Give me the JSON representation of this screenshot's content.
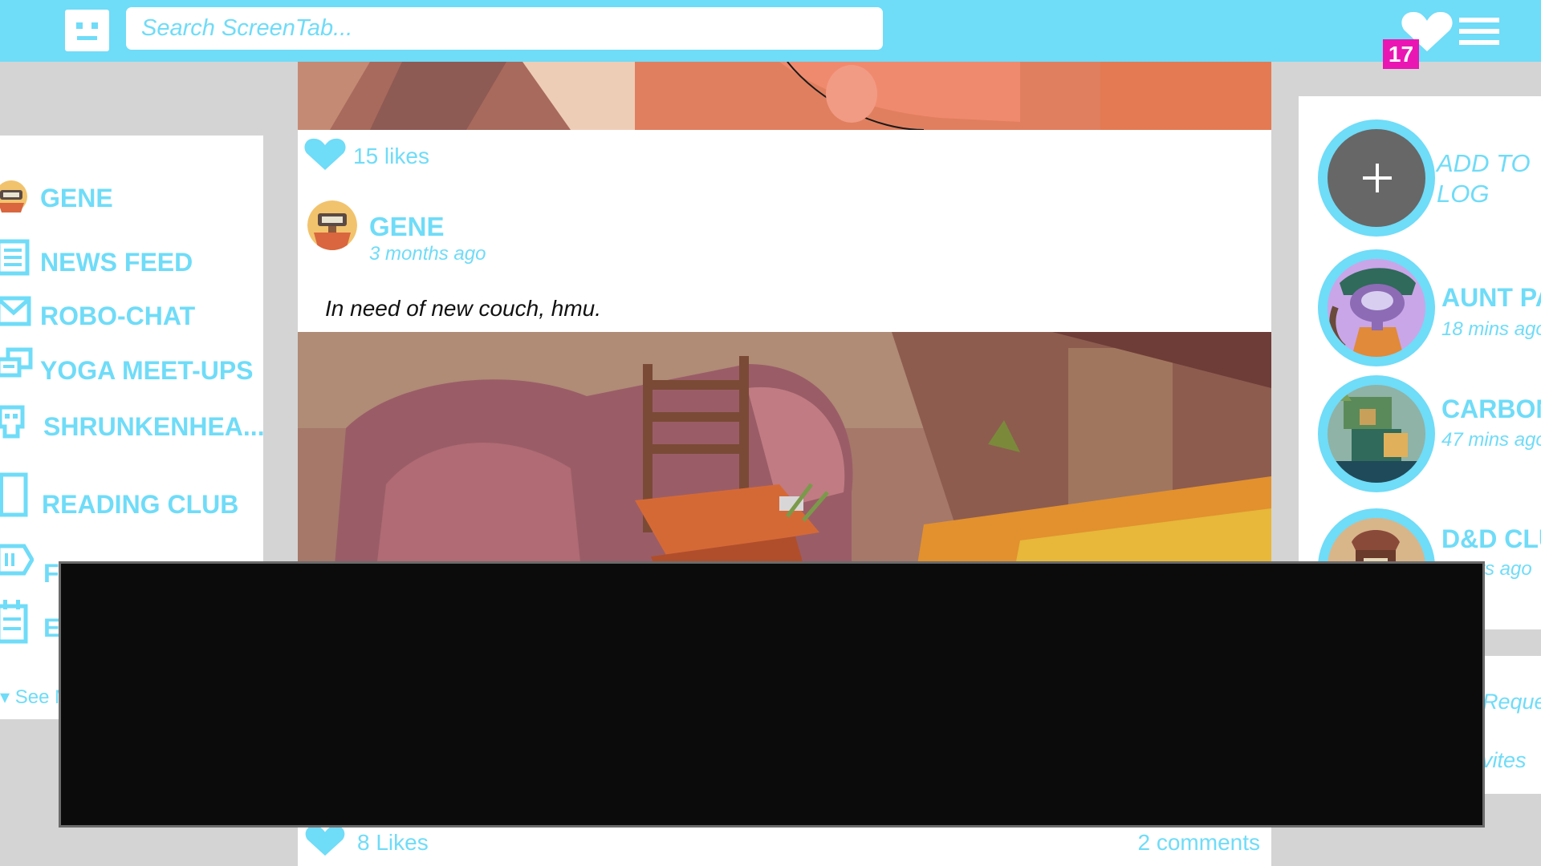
{
  "colors": {
    "accent": "#6fdcf8",
    "background": "#d4d4d4",
    "badge": "#ea16b3",
    "overlay": "#0b0b0b"
  },
  "topbar": {
    "logo_icon": "robot-face-icon",
    "search_placeholder": "Search ScreenTab...",
    "notification_icon": "heart-icon",
    "notification_count": "17",
    "menu_icon": "hamburger-menu-icon"
  },
  "sidebar": {
    "items": [
      {
        "label": "GENE",
        "icon": "avatar-icon"
      },
      {
        "label": "NEWS FEED",
        "icon": "newspaper-icon"
      },
      {
        "label": "ROBO-CHAT",
        "icon": "mail-icon"
      },
      {
        "label": "YOGA MEET-UPS",
        "icon": "chat-bubbles-icon"
      },
      {
        "label": "SHRUNKENHEA...",
        "icon": "skull-icon"
      },
      {
        "label": "READING CLUB",
        "icon": "book-icon"
      },
      {
        "label": "F",
        "icon": "tag-icon"
      },
      {
        "label": "E",
        "icon": "calendar-icon"
      }
    ],
    "see_more": "See M"
  },
  "feed": {
    "top_post": {
      "likes": "15 likes"
    },
    "post": {
      "author": "GENE",
      "time": "3 months ago",
      "text": "In need of new couch, hmu.",
      "likes": "8 Likes",
      "comments": "2 comments"
    }
  },
  "right_panel": {
    "add_label": "ADD TO LOG",
    "friends": [
      {
        "name": "AUNT PA",
        "time": "18 mins ago"
      },
      {
        "name": "CARBON",
        "time": "47 mins ago"
      },
      {
        "name": "D&D CLU",
        "time": "rs ago"
      }
    ],
    "links": [
      "Reque",
      "vites"
    ]
  }
}
